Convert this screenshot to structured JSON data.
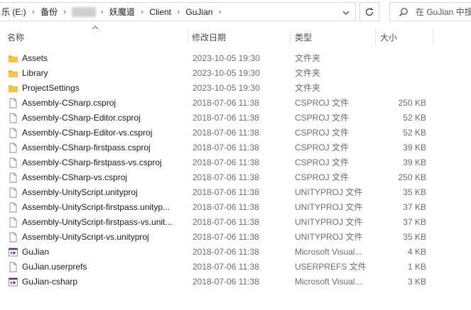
{
  "address_bar": {
    "crumbs": [
      "乐 (E:)",
      "备份",
      "",
      "妖魔道",
      "Client",
      "GuJian"
    ]
  },
  "search": {
    "placeholder": "在 GuJian 中搜"
  },
  "columns": {
    "name": "名称",
    "date": "修改日期",
    "type": "类型",
    "size": "大小"
  },
  "files": [
    {
      "name": "Assets",
      "date": "2023-10-05 19:30",
      "type": "文件夹",
      "size": "",
      "icon": "folder-icon"
    },
    {
      "name": "Library",
      "date": "2023-10-05 19:30",
      "type": "文件夹",
      "size": "",
      "icon": "folder-icon"
    },
    {
      "name": "ProjectSettings",
      "date": "2023-10-05 19:30",
      "type": "文件夹",
      "size": "",
      "icon": "folder-icon"
    },
    {
      "name": "Assembly-CSharp.csproj",
      "date": "2018-07-06 11:38",
      "type": "CSPROJ 文件",
      "size": "250 KB",
      "icon": "file-icon"
    },
    {
      "name": "Assembly-CSharp-Editor.csproj",
      "date": "2018-07-06 11:38",
      "type": "CSPROJ 文件",
      "size": "52 KB",
      "icon": "file-icon"
    },
    {
      "name": "Assembly-CSharp-Editor-vs.csproj",
      "date": "2018-07-06 11:38",
      "type": "CSPROJ 文件",
      "size": "52 KB",
      "icon": "file-icon"
    },
    {
      "name": "Assembly-CSharp-firstpass.csproj",
      "date": "2018-07-06 11:38",
      "type": "CSPROJ 文件",
      "size": "39 KB",
      "icon": "file-icon"
    },
    {
      "name": "Assembly-CSharp-firstpass-vs.csproj",
      "date": "2018-07-06 11:38",
      "type": "CSPROJ 文件",
      "size": "39 KB",
      "icon": "file-icon"
    },
    {
      "name": "Assembly-CSharp-vs.csproj",
      "date": "2018-07-06 11:38",
      "type": "CSPROJ 文件",
      "size": "250 KB",
      "icon": "file-icon"
    },
    {
      "name": "Assembly-UnityScript.unityproj",
      "date": "2018-07-06 11:38",
      "type": "UNITYPROJ 文件",
      "size": "35 KB",
      "icon": "file-icon"
    },
    {
      "name": "Assembly-UnityScript-firstpass.unityp...",
      "date": "2018-07-06 11:38",
      "type": "UNITYPROJ 文件",
      "size": "37 KB",
      "icon": "file-icon"
    },
    {
      "name": "Assembly-UnityScript-firstpass-vs.unit...",
      "date": "2018-07-06 11:38",
      "type": "UNITYPROJ 文件",
      "size": "37 KB",
      "icon": "file-icon"
    },
    {
      "name": "Assembly-UnityScript-vs.unityproj",
      "date": "2018-07-06 11:38",
      "type": "UNITYPROJ 文件",
      "size": "35 KB",
      "icon": "file-icon"
    },
    {
      "name": "GuJian",
      "date": "2018-07-06 11:38",
      "type": "Microsoft Visual...",
      "size": "4 KB",
      "icon": "visual-studio-icon"
    },
    {
      "name": "GuJian.userprefs",
      "date": "2018-07-06 11:38",
      "type": "USERPREFS 文件",
      "size": "1 KB",
      "icon": "file-icon"
    },
    {
      "name": "GuJian-csharp",
      "date": "2018-07-06 11:38",
      "type": "Microsoft Visual...",
      "size": "3 KB",
      "icon": "visual-studio-icon"
    }
  ],
  "colors": {
    "folder": "#f6c545",
    "folder_dark": "#e2a92a",
    "vs_purple": "#68217a"
  }
}
